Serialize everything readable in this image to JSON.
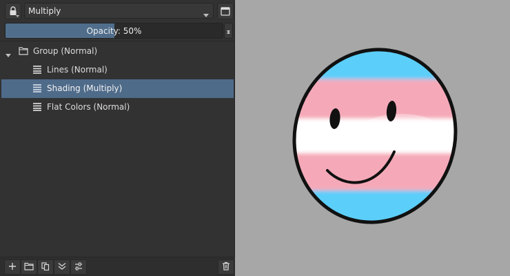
{
  "layers_panel": {
    "blending_mode": {
      "selected": "Multiply"
    },
    "opacity": {
      "label": "Opacity: 50%",
      "value_percent": 50
    },
    "layers": [
      {
        "name": "Group (Normal)",
        "type": "group",
        "expanded": true,
        "depth": 0,
        "selected": false
      },
      {
        "name": "Lines (Normal)",
        "type": "paint",
        "depth": 1,
        "selected": false
      },
      {
        "name": "Shading (Multiply)",
        "type": "paint",
        "depth": 1,
        "selected": true
      },
      {
        "name": "Flat Colors (Normal)",
        "type": "paint",
        "depth": 1,
        "selected": false
      }
    ],
    "toolbar_icons": [
      "add-layer-icon",
      "add-group-icon",
      "duplicate-layer-icon",
      "merge-down-icon",
      "layer-properties-icon",
      "delete-layer-icon"
    ]
  },
  "canvas": {
    "background": "#a7a7a7",
    "artwork": {
      "subject": "smiley face ball",
      "stripe_colors": [
        "#5bcefa",
        "#f5a9b8",
        "#ffffff",
        "#f5a9b8",
        "#5bcefa"
      ]
    }
  },
  "theme": {
    "panel_bg": "#323232",
    "selection": "#4f6b8a",
    "opacity_fill": "#506e8c"
  }
}
